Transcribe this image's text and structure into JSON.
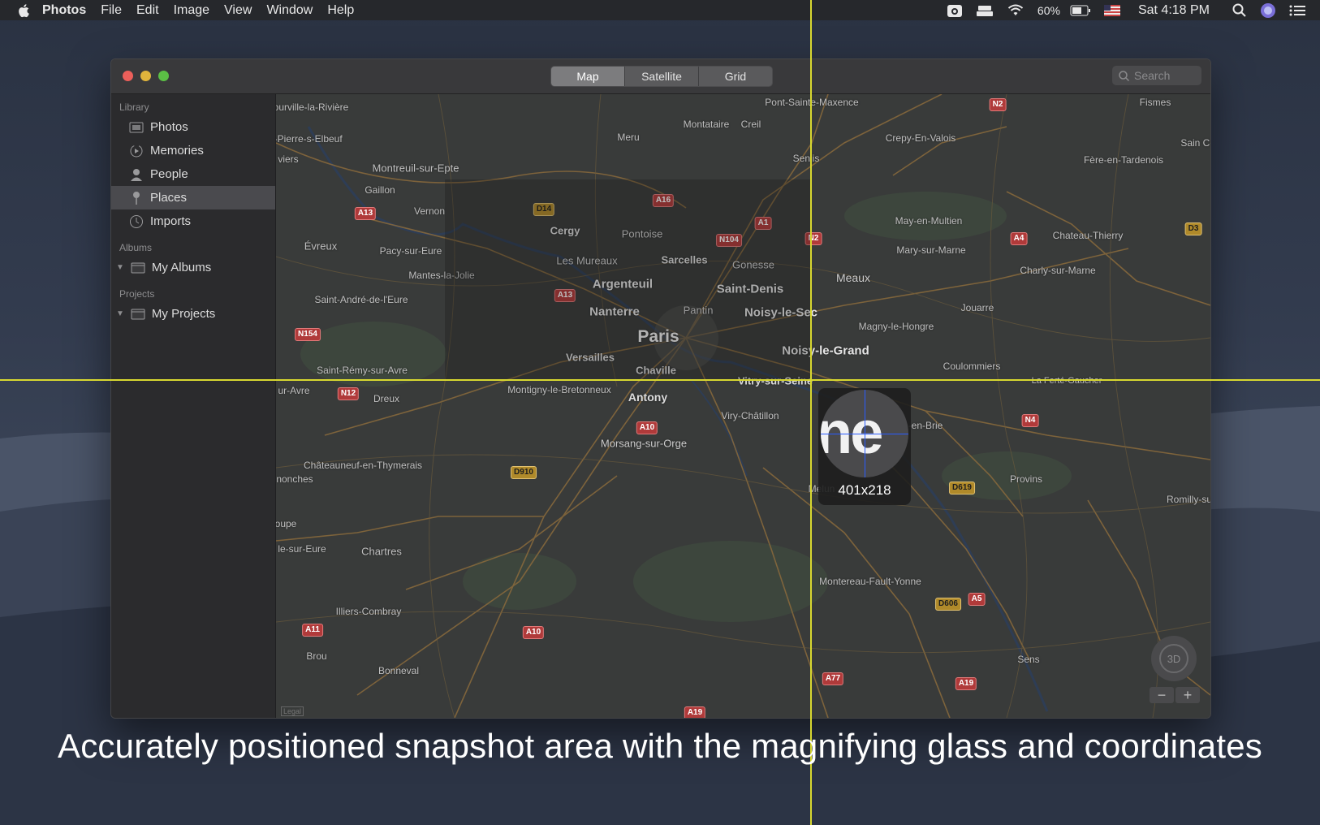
{
  "menubar": {
    "app_name": "Photos",
    "menus": [
      "File",
      "Edit",
      "Image",
      "View",
      "Window",
      "Help"
    ],
    "battery": "60%",
    "clock": "Sat 4:18 PM",
    "icons": [
      "camera-icon",
      "drive-icon",
      "wifi-icon",
      "battery-icon",
      "flag-icon",
      "spotlight-icon",
      "siri-icon",
      "notification-center-icon"
    ]
  },
  "window": {
    "tabs": [
      {
        "label": "Map",
        "active": true
      },
      {
        "label": "Satellite",
        "active": false
      },
      {
        "label": "Grid",
        "active": false
      }
    ],
    "search_placeholder": "Search"
  },
  "sidebar": {
    "library_header": "Library",
    "library_items": [
      {
        "label": "Photos",
        "icon": "photos-icon"
      },
      {
        "label": "Memories",
        "icon": "memories-icon"
      },
      {
        "label": "People",
        "icon": "people-icon"
      },
      {
        "label": "Places",
        "icon": "pin-icon",
        "selected": true
      },
      {
        "label": "Imports",
        "icon": "clock-icon"
      }
    ],
    "albums_header": "Albums",
    "albums_item": "My Albums",
    "projects_header": "Projects",
    "projects_item": "My Projects"
  },
  "map": {
    "places_large": [
      "Paris"
    ],
    "places_medium": [
      "Argenteuil",
      "Saint-Denis",
      "Nanterre",
      "Noisy-le-Sec",
      "Noisy-le-Grand",
      "Cergy",
      "Sarcelles",
      "Chaville",
      "Versailles",
      "Antony",
      "Meaux",
      "Vitry-sur-Seine"
    ],
    "places_small": [
      "Tourville-la-Rivière",
      "aint-Pierre-s-Elbeuf",
      "viers",
      "Montreuil-sur-Epte",
      "Gaillon",
      "Vernon",
      "Évreux",
      "Pacy-sur-Eure",
      "Mantes-la-Jolie",
      "Saint-André-de-l'Eure",
      "Saint-Rémy-sur-Avre",
      "ur-Avre",
      "Dreux",
      "Montigny-le-Bretonneux",
      "Meru",
      "Montataire",
      "Creil",
      "Senlis",
      "Pont-Sainte-Maxence",
      "Crepy-En-Valois",
      "Fismes",
      "Fère-en-Tardenois",
      "Sain Cou",
      "Pontoise",
      "Les Mureaux",
      "Gonesse",
      "Pantin",
      "May-en-Multien",
      "Mary-sur-Marne",
      "Chateau-Thierry",
      "Charly-sur-Marne",
      "Jouarre",
      "Magny-le-Hongre",
      "Coulommiers",
      "La Ferté-Gaucher",
      "Viry-Châtillon",
      "Morsang-sur-Orge",
      "-en-Brie",
      "Provins",
      "Romilly-su",
      "Châteauneuf-en-Thymerais",
      "nonches",
      "oupe",
      "le-sur-Eure",
      "Chartres",
      "Melun",
      "Montereau-Fault-Yonne",
      "Illiers-Combray",
      "Brou",
      "Bonneval",
      "Sens"
    ],
    "shields": [
      "N2",
      "A16",
      "D14",
      "A1",
      "A13",
      "N104",
      "N2",
      "A4",
      "D3",
      "A13",
      "N154",
      "N12",
      "A10",
      "D910",
      "D619",
      "N4",
      "A5",
      "D606",
      "A10",
      "A11",
      "A77",
      "A19",
      "A19"
    ],
    "compass_label": "3D",
    "zoom_out": "−",
    "zoom_in": "+",
    "legal": "Legal"
  },
  "capture_tool": {
    "coordinates": "401x218",
    "magnified_text": "ne",
    "crosshair_color": "#d8d830"
  },
  "caption": "Accurately positioned snapshot area with the magnifying glass and coordinates"
}
